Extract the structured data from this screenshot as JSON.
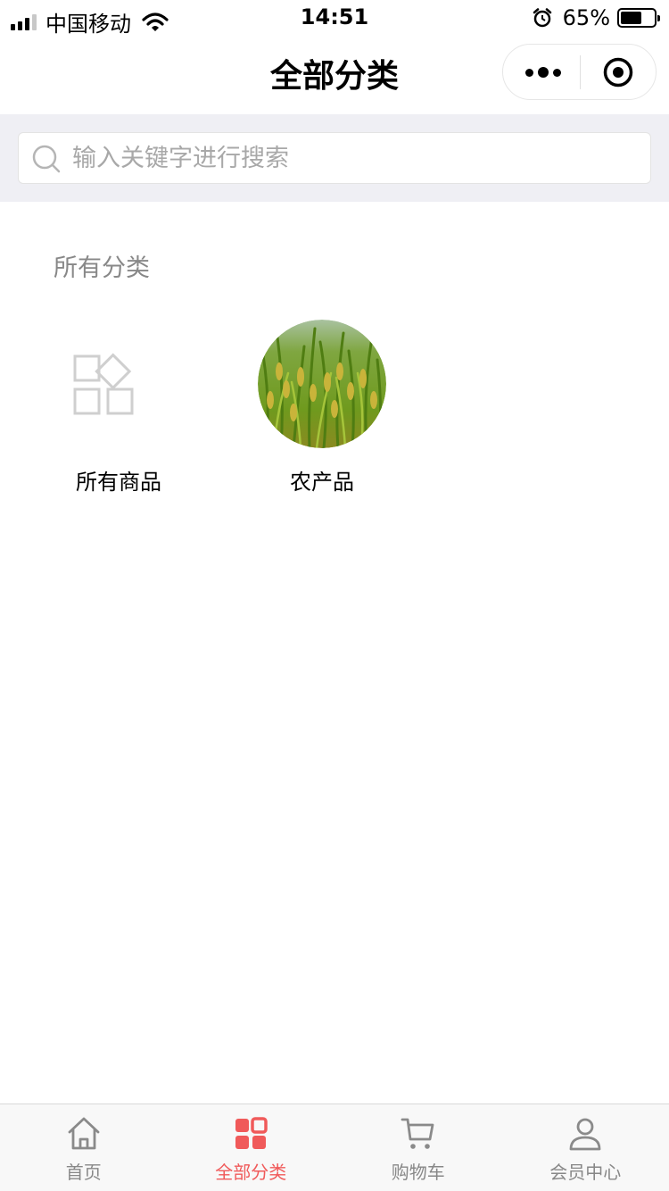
{
  "status_bar": {
    "carrier": "中国移动",
    "time": "14:51",
    "battery_percent": "65%",
    "battery_level": 0.65,
    "icons": [
      "signal-icon",
      "wifi-icon",
      "alarm-icon",
      "battery-icon"
    ]
  },
  "nav": {
    "title": "全部分类",
    "capsule_icons": [
      "more-icon",
      "close-target-icon"
    ]
  },
  "search": {
    "placeholder": "输入关键字进行搜索",
    "value": "",
    "icon": "search-icon"
  },
  "main": {
    "section_title": "所有分类",
    "categories": [
      {
        "label": "所有商品",
        "icon": "category-grid-icon"
      },
      {
        "label": "农产品",
        "image": "rice-field-photo"
      }
    ]
  },
  "tab_bar": {
    "active_index": 1,
    "active_color": "#f05a5a",
    "inactive_color": "#888888",
    "tabs": [
      {
        "label": "首页",
        "icon": "home-icon"
      },
      {
        "label": "全部分类",
        "icon": "category-icon"
      },
      {
        "label": "购物车",
        "icon": "cart-icon"
      },
      {
        "label": "会员中心",
        "icon": "user-icon"
      }
    ]
  }
}
